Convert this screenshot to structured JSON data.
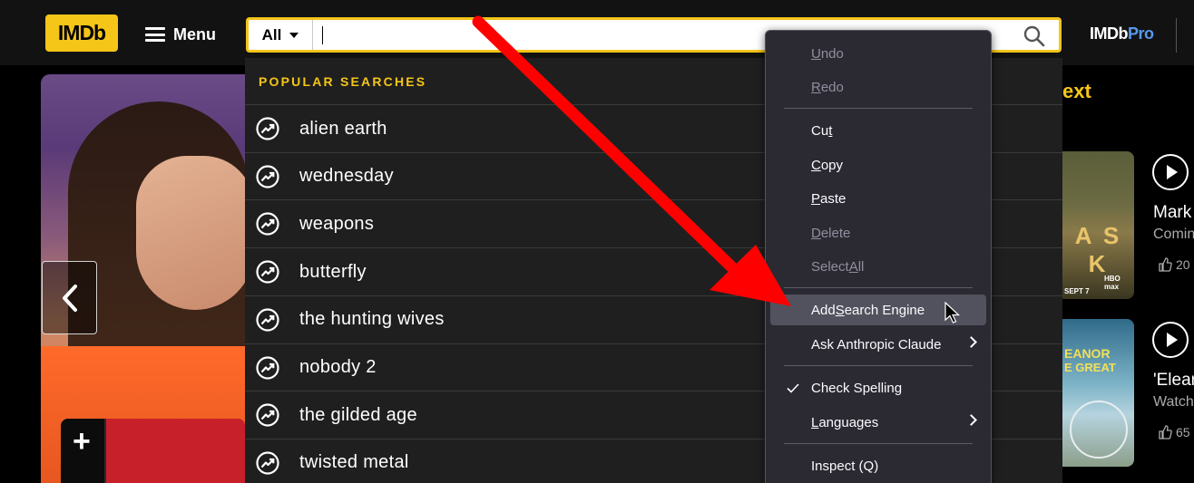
{
  "header": {
    "logo_text": "IMDb",
    "menu_label": "Menu",
    "search_scope": "All",
    "search_value": "",
    "imdbpro_prefix": "IMDb",
    "imdbpro_suffix": "Pro"
  },
  "popular_searches": {
    "heading": "POPULAR SEARCHES",
    "items": [
      {
        "label": "alien earth"
      },
      {
        "label": "wednesday"
      },
      {
        "label": "weapons"
      },
      {
        "label": "butterfly"
      },
      {
        "label": "the hunting wives"
      },
      {
        "label": "nobody 2"
      },
      {
        "label": "the gilded age"
      },
      {
        "label": "twisted metal"
      }
    ]
  },
  "context_menu": {
    "undo": {
      "pre": "",
      "acc": "U",
      "post": "ndo",
      "enabled": false
    },
    "redo": {
      "pre": "",
      "acc": "R",
      "post": "edo",
      "enabled": false
    },
    "cut": {
      "pre": "Cu",
      "acc": "t",
      "post": "",
      "enabled": true
    },
    "copy": {
      "pre": "",
      "acc": "C",
      "post": "opy",
      "enabled": true
    },
    "paste": {
      "pre": "",
      "acc": "P",
      "post": "aste",
      "enabled": true
    },
    "delete": {
      "pre": "",
      "acc": "D",
      "post": "elete",
      "enabled": false
    },
    "select_all": {
      "pre": "Select ",
      "acc": "A",
      "post": "ll",
      "enabled": false
    },
    "add_search_engine": {
      "pre": "Add ",
      "acc": "S",
      "post": "earch Engine",
      "enabled": true,
      "hovered": true
    },
    "ask_claude": {
      "label": "Ask Anthropic Claude",
      "submenu": true
    },
    "check_spelling": {
      "label": "Check Spelling",
      "checked": true
    },
    "languages": {
      "pre": "",
      "acc": "L",
      "post": "anguages",
      "submenu": true
    },
    "inspect": {
      "label": "Inspect (Q)"
    }
  },
  "up_next": {
    "heading_partial": "ext",
    "cards": [
      {
        "title_partial": "Mark",
        "subtitle_partial": "Comin",
        "likes_partial": "20",
        "poster_text": "A S K",
        "poster_brand": "HBO max",
        "poster_date": "SEPT 7"
      },
      {
        "title_partial": "'Elear",
        "subtitle_partial": "Watch",
        "likes_partial": "65",
        "poster_text_1": "EANOR",
        "poster_text_2": "E GREAT"
      }
    ]
  },
  "colors": {
    "brand_yellow": "#f5c518",
    "header_bg": "#121212",
    "dropdown_bg": "#1f1f1f",
    "menu_bg": "#2b2a33",
    "arrow_red": "#ff0000"
  }
}
